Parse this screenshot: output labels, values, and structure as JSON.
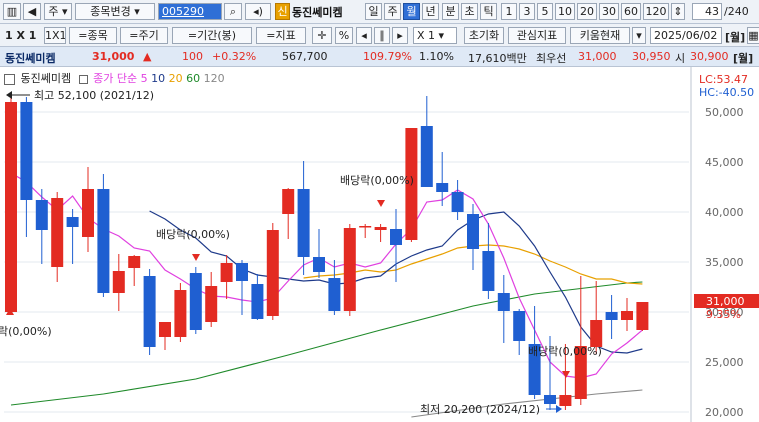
{
  "toolbar": {
    "market": "주",
    "code_menu": "종목변경",
    "code": "005290",
    "credit_badge": "신",
    "stock_name": "동진쎄미켐",
    "periods": [
      "일",
      "주",
      "월",
      "년",
      "분",
      "초",
      "틱"
    ],
    "active_period": "월",
    "intervals": [
      "1",
      "3",
      "5",
      "10",
      "20",
      "30",
      "60",
      "120"
    ],
    "page_counter": "43",
    "page_total": "/240"
  },
  "toolbar2": {
    "ratio": "1 X 1",
    "ratio_btn": "1X1",
    "buttons": [
      "=종목",
      "=주기",
      "=기간(봉)",
      "=지표"
    ],
    "percent": "%",
    "zoom": "X 1",
    "reset": "초기화",
    "interest": "관심지표",
    "kiwoom": "키움현재",
    "date": "2025/06/02",
    "period_tag": "[월]"
  },
  "quote": {
    "name": "동진쎄미켐",
    "price": "31,000",
    "arrow": "▲",
    "change": "100",
    "change_pct": "+0.32%",
    "volume": "567,700",
    "vol_ratio": "109.79%",
    "turnover_pct": "1.10%",
    "amount": "17,610백만",
    "best_ask_label": "최우선",
    "best_ask": "31,000",
    "best_bid": "30,950",
    "open_label": "시",
    "open": "30,900"
  },
  "legend": {
    "name": "동진쎄미켐",
    "ma_label": "종가 단순",
    "ma": [
      "5",
      "10",
      "20",
      "60",
      "120"
    ],
    "ma_colors": [
      "#e040e0",
      "#1e3a8a",
      "#e8a000",
      "#1f8a2a",
      "#888888"
    ]
  },
  "right_info": {
    "lc": "LC:53.47",
    "hc": "HC:-40.50",
    "price_tag": "31,000",
    "pct_tag": "9.35%"
  },
  "annotations": {
    "high": "최고 52,100 (2021/12)",
    "low": "최저 20,200 (2024/12)",
    "dividend": "배당락(0,00%)",
    "left_partial": "락(0,00%)"
  },
  "colors": {
    "up": "#e32b22",
    "down": "#1f5fd1",
    "ma5": "#e040e0",
    "ma10": "#1e3a8a",
    "ma20": "#e8a000",
    "ma60": "#1f8a2a",
    "ma120": "#888888"
  },
  "chart_data": {
    "type": "candlestick",
    "ylim": [
      19500,
      53500
    ],
    "yticks": [
      "50,000",
      "45,000",
      "40,000",
      "35,000",
      "30,000",
      "25,000",
      "20,000"
    ],
    "candles": [
      {
        "o": 30000,
        "h": 52000,
        "l": 29800,
        "c": 51000
      },
      {
        "o": 51000,
        "h": 51500,
        "l": 37500,
        "c": 41200
      },
      {
        "o": 41200,
        "h": 42300,
        "l": 34800,
        "c": 38200
      },
      {
        "o": 34500,
        "h": 42000,
        "l": 33000,
        "c": 41400
      },
      {
        "o": 39500,
        "h": 40300,
        "l": 34800,
        "c": 38500
      },
      {
        "o": 37500,
        "h": 44500,
        "l": 36000,
        "c": 42300
      },
      {
        "o": 42300,
        "h": 43800,
        "l": 31500,
        "c": 31900
      },
      {
        "o": 31900,
        "h": 35800,
        "l": 30100,
        "c": 34100
      },
      {
        "o": 34400,
        "h": 35700,
        "l": 32600,
        "c": 35600
      },
      {
        "o": 33600,
        "h": 34300,
        "l": 25700,
        "c": 26500
      },
      {
        "o": 27500,
        "h": 29000,
        "l": 26200,
        "c": 29000
      },
      {
        "o": 27500,
        "h": 32900,
        "l": 27000,
        "c": 32200
      },
      {
        "o": 33900,
        "h": 34500,
        "l": 27800,
        "c": 28200
      },
      {
        "o": 29000,
        "h": 34000,
        "l": 28500,
        "c": 32600
      },
      {
        "o": 33000,
        "h": 35700,
        "l": 31300,
        "c": 34900
      },
      {
        "o": 34900,
        "h": 35200,
        "l": 29700,
        "c": 33100
      },
      {
        "o": 32800,
        "h": 33800,
        "l": 29200,
        "c": 29300
      },
      {
        "o": 29600,
        "h": 38900,
        "l": 29200,
        "c": 38200
      },
      {
        "o": 39800,
        "h": 42400,
        "l": 37300,
        "c": 42300
      },
      {
        "o": 42300,
        "h": 45100,
        "l": 33700,
        "c": 35500
      },
      {
        "o": 35500,
        "h": 38300,
        "l": 33400,
        "c": 34000
      },
      {
        "o": 33400,
        "h": 35200,
        "l": 29700,
        "c": 30100
      },
      {
        "o": 30100,
        "h": 38800,
        "l": 29600,
        "c": 38400
      },
      {
        "o": 38500,
        "h": 38800,
        "l": 37400,
        "c": 38600
      },
      {
        "o": 38200,
        "h": 38800,
        "l": 37000,
        "c": 38500
      },
      {
        "o": 38300,
        "h": 40300,
        "l": 33000,
        "c": 36700
      },
      {
        "o": 37200,
        "h": 47500,
        "l": 37000,
        "c": 48400
      },
      {
        "o": 48600,
        "h": 51600,
        "l": 44000,
        "c": 42500
      },
      {
        "o": 42900,
        "h": 46000,
        "l": 40600,
        "c": 42000
      },
      {
        "o": 42000,
        "h": 43200,
        "l": 39200,
        "c": 40000
      },
      {
        "o": 39800,
        "h": 40800,
        "l": 34200,
        "c": 36300
      },
      {
        "o": 36100,
        "h": 38900,
        "l": 31300,
        "c": 32100
      },
      {
        "o": 31900,
        "h": 33700,
        "l": 26900,
        "c": 30100
      },
      {
        "o": 30100,
        "h": 30300,
        "l": 25700,
        "c": 27100
      },
      {
        "o": 26800,
        "h": 30600,
        "l": 21300,
        "c": 21700
      },
      {
        "o": 21700,
        "h": 27600,
        "l": 20200,
        "c": 20800
      },
      {
        "o": 20600,
        "h": 26800,
        "l": 20200,
        "c": 21700
      },
      {
        "o": 21300,
        "h": 33600,
        "l": 20700,
        "c": 26600
      },
      {
        "o": 26500,
        "h": 33100,
        "l": 25800,
        "c": 29200
      },
      {
        "o": 30000,
        "h": 31700,
        "l": 27300,
        "c": 29200
      },
      {
        "o": 29200,
        "h": 31400,
        "l": 28100,
        "c": 30100
      },
      {
        "o": 28200,
        "h": 31000,
        "l": 28100,
        "c": 31000
      }
    ],
    "ma5": [
      43900,
      43000,
      41500,
      40200,
      41600,
      39400,
      38300,
      37600,
      36400,
      36100,
      34200,
      33300,
      32300,
      31600,
      31500,
      31200,
      31000,
      31400,
      33100,
      34700,
      35400,
      34500,
      34900,
      34500,
      34900,
      36800,
      38300,
      41000,
      41200,
      42200,
      41300,
      38800,
      35400,
      31400,
      28200,
      25000,
      23600,
      23400,
      23800,
      25800,
      26900,
      28200
    ],
    "ma10": [
      null,
      null,
      null,
      null,
      null,
      null,
      null,
      null,
      null,
      40100,
      39300,
      38200,
      37400,
      36000,
      35600,
      34300,
      33700,
      33500,
      33300,
      33100,
      33200,
      32800,
      32900,
      33400,
      33600,
      34800,
      35600,
      36200,
      36600,
      38200,
      39200,
      39800,
      40000,
      38600,
      36600,
      34000,
      31500,
      28500,
      26600,
      26000,
      25900,
      26300
    ],
    "ma20": [
      null,
      null,
      null,
      null,
      null,
      null,
      null,
      null,
      null,
      null,
      null,
      null,
      null,
      null,
      null,
      null,
      null,
      null,
      null,
      33400,
      33600,
      33700,
      33900,
      34200,
      34000,
      34200,
      34800,
      35300,
      35800,
      36400,
      36600,
      36700,
      36600,
      36300,
      35800,
      35100,
      34500,
      33800,
      33300,
      33300,
      32900,
      32800
    ],
    "ma60": [
      null,
      null,
      null,
      null,
      null,
      null,
      null,
      null,
      null,
      null,
      null,
      null,
      null,
      null,
      null,
      null,
      null,
      null,
      null,
      null,
      null,
      null,
      null,
      null,
      null,
      null,
      null,
      null,
      null,
      null,
      null,
      null,
      null,
      null,
      null,
      null,
      null,
      null,
      null,
      null,
      null,
      null
    ],
    "ma60_path": [
      [
        0,
        20700
      ],
      [
        6,
        21800
      ],
      [
        12,
        23300
      ],
      [
        18,
        25700
      ],
      [
        24,
        28200
      ],
      [
        30,
        30600
      ],
      [
        34,
        31800
      ],
      [
        40,
        32900
      ],
      [
        41,
        33000
      ]
    ],
    "ma120_path": [
      [
        26,
        19500
      ],
      [
        32,
        20800
      ],
      [
        38,
        21800
      ],
      [
        41,
        22200
      ]
    ]
  }
}
